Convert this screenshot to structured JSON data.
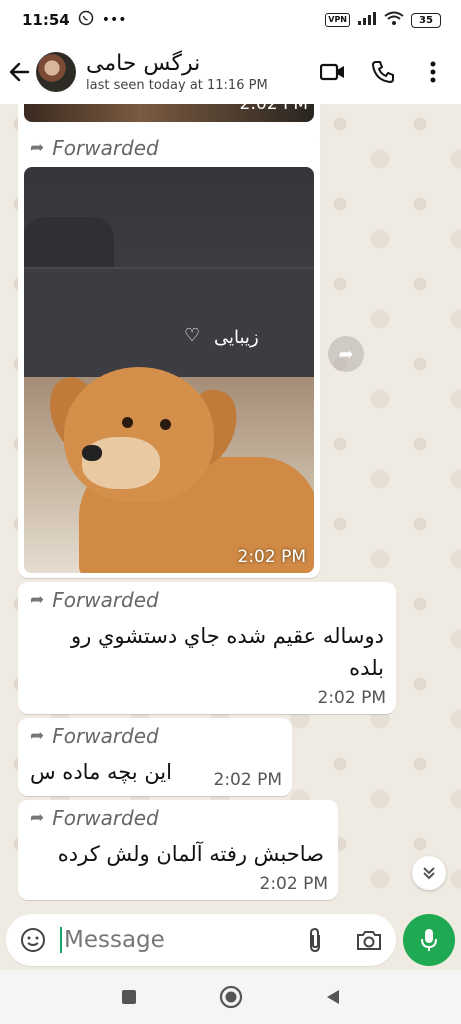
{
  "status_bar": {
    "time": "11:54",
    "vpn_label": "VPN",
    "battery": "35"
  },
  "header": {
    "contact_name": "نرگس حامی",
    "last_seen": "last seen today at 11:16 PM"
  },
  "messages": {
    "partial_time": "2:02 PM",
    "image": {
      "forwarded_label": "Forwarded",
      "overlay_text": "زیبایی",
      "time": "2:02 PM"
    },
    "msg1": {
      "forwarded_label": "Forwarded",
      "text": "دوساله عقیم شده جاي دستشوي رو بلده",
      "time": "2:02 PM"
    },
    "msg2": {
      "forwarded_label": "Forwarded",
      "text": "این بچه ماده س",
      "time": "2:02 PM"
    },
    "msg3": {
      "forwarded_label": "Forwarded",
      "text": "صاحبش رفته آلمان ولش کرده",
      "time": "2:02 PM"
    }
  },
  "composer": {
    "placeholder": "Message"
  },
  "colors": {
    "accent_green": "#1ea952",
    "chat_background": "#efeae2",
    "bubble": "#ffffff"
  },
  "icons": [
    "whatsapp-icon",
    "more-dots-icon",
    "signal-icon",
    "wifi-icon",
    "back-arrow-icon",
    "video-call-icon",
    "phone-icon",
    "menu-icon",
    "forward-icon",
    "scroll-down-icon",
    "sticker-icon",
    "attach-icon",
    "camera-icon",
    "mic-icon",
    "nav-recents-icon",
    "nav-home-icon",
    "nav-back-icon"
  ]
}
